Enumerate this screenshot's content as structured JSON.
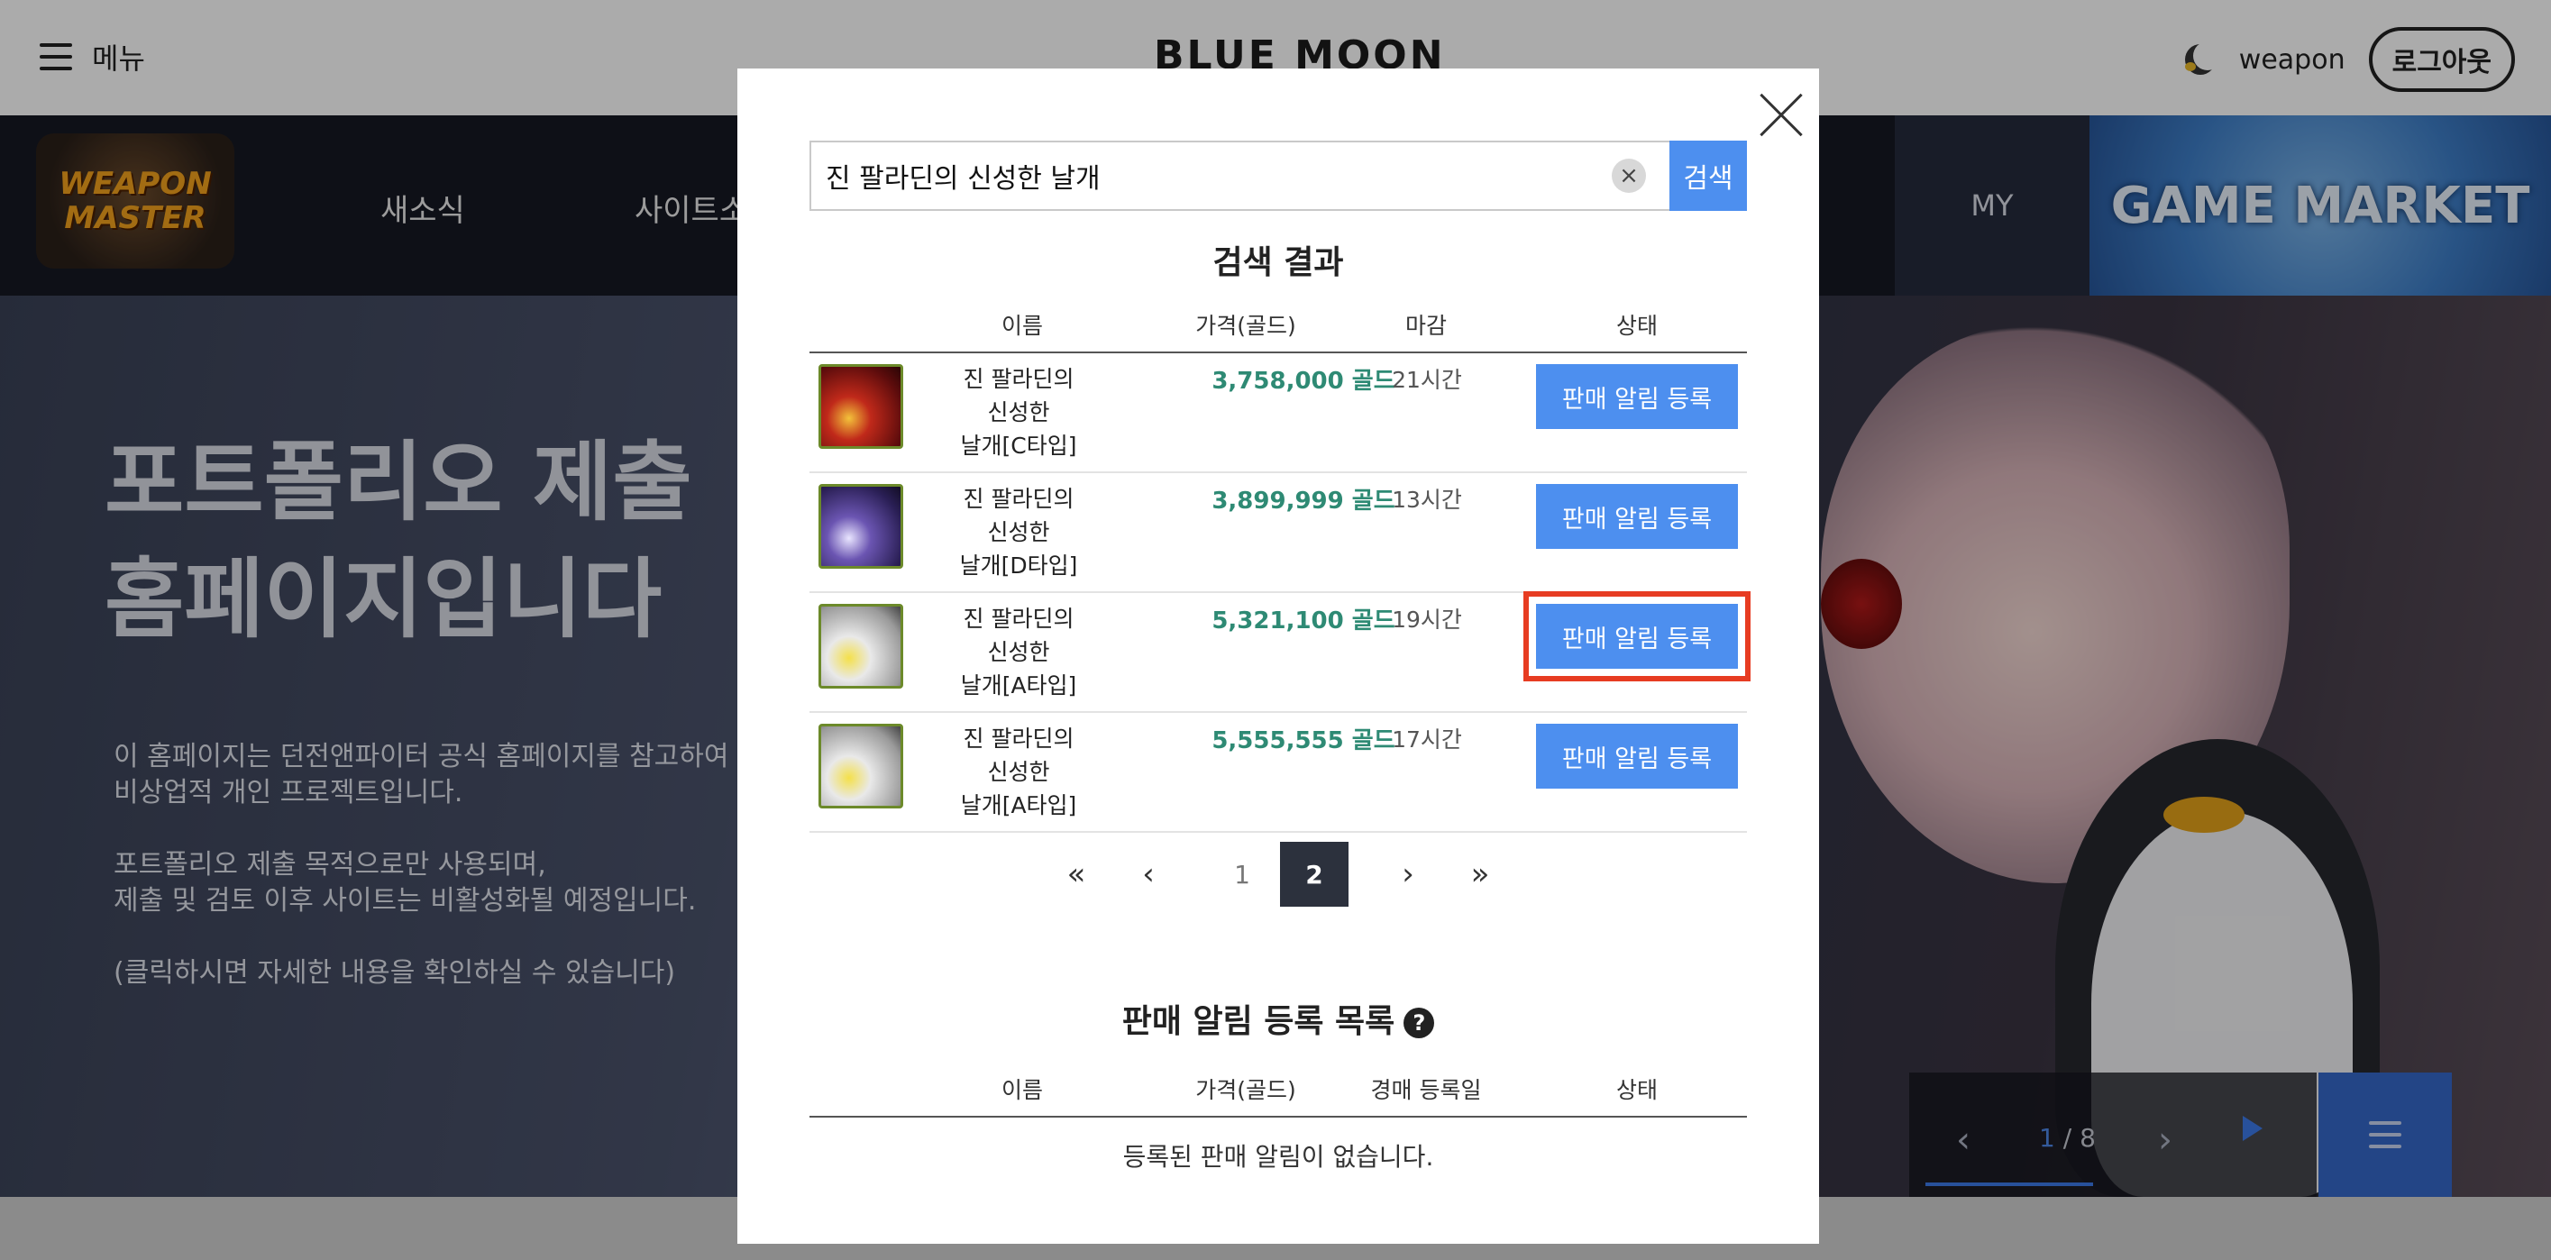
{
  "header": {
    "menu_label": "메뉴",
    "brand": "BLUE MOON",
    "username": "weapon",
    "logout_label": "로그아웃"
  },
  "nav": {
    "logo_text": [
      "WEAPON",
      "MASTER"
    ],
    "items": [
      "새소식",
      "사이트소"
    ],
    "my_label": "MY",
    "market_label": "GAME MARKET"
  },
  "hero": {
    "title_lines": [
      "포트폴리오 제출",
      "홈페이지입니다"
    ],
    "desc_1": [
      "이 홈페이지는 던전앤파이터 공식 홈페이지를 참고하여",
      "비상업적 개인 프로젝트입니다."
    ],
    "desc_2": [
      "포트폴리오 제출 목적으로만 사용되며,",
      "제출 및 검토 이후 사이트는 비활성화될 예정입니다."
    ],
    "desc_3": "(클릭하시면 자세한 내용을 확인하실 수 있습니다)"
  },
  "slider": {
    "current": "1",
    "total": "8"
  },
  "search": {
    "value": "진 팔라딘의 신성한 날개",
    "button_label": "검색"
  },
  "results": {
    "title": "검색 결과",
    "columns": [
      "이름",
      "가격(골드)",
      "마감",
      "상태"
    ],
    "rows": [
      {
        "name": [
          "진 팔라딘의",
          "신성한",
          "날개[C타입]"
        ],
        "price": "3,758,000 골드",
        "deadline": "21시간",
        "action": "판매 알림 등록",
        "thumb": "red"
      },
      {
        "name": [
          "진 팔라딘의",
          "신성한",
          "날개[D타입]"
        ],
        "price": "3,899,999 골드",
        "deadline": "13시간",
        "action": "판매 알림 등록",
        "thumb": "purple"
      },
      {
        "name": [
          "진 팔라딘의",
          "신성한",
          "날개[A타입]"
        ],
        "price": "5,321,100 골드",
        "deadline": "19시간",
        "action": "판매 알림 등록",
        "thumb": "white"
      },
      {
        "name": [
          "진 팔라딘의",
          "신성한",
          "날개[A타입]"
        ],
        "price": "5,555,555 골드",
        "deadline": "17시간",
        "action": "판매 알림 등록",
        "thumb": "white"
      }
    ]
  },
  "pagination": {
    "first": "«",
    "prev": "‹",
    "pages": [
      "1",
      "2"
    ],
    "active_page": "2",
    "next": "›",
    "last": "»"
  },
  "alerts": {
    "title": "판매 알림 등록 목록",
    "help": "?",
    "columns": [
      "이름",
      "가격(골드)",
      "경매 등록일",
      "상태"
    ],
    "empty_message": "등록된 판매 알림이 없습니다."
  },
  "colors": {
    "accent": "#4d8fef",
    "price_green": "#2e8a74",
    "highlight_red": "#e73c22",
    "active_page": "#2c313d"
  }
}
